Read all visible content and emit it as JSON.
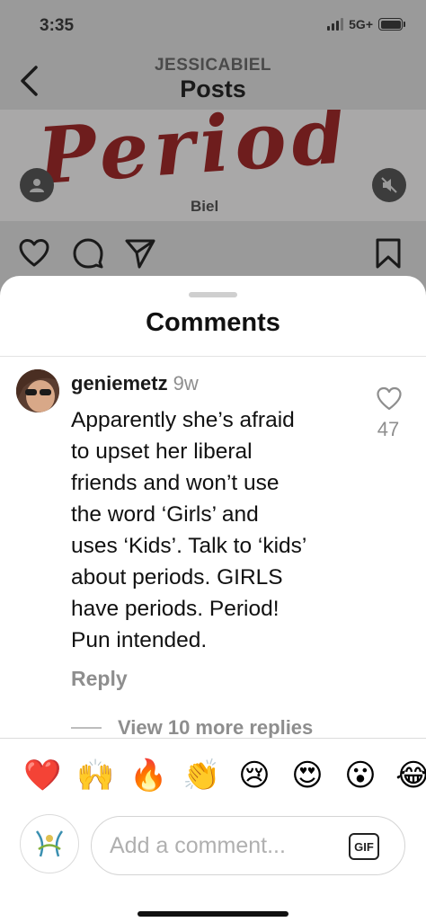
{
  "status_bar": {
    "time": "3:35",
    "network": "5G+"
  },
  "nav": {
    "username": "JESSICABIEL",
    "title": "Posts"
  },
  "post": {
    "image_text": "Period",
    "image_caption": "Biel"
  },
  "comments_sheet": {
    "title": "Comments",
    "comment": {
      "username": "geniemetz",
      "time": "9w",
      "text": "Apparently she’s afraid\nto upset her liberal\nfriends and won’t use\nthe word ‘Girls’ and\nuses ‘Kids’. Talk to ‘kids’\nabout periods. GIRLS\nhave periods.  Period!\nPun intended.",
      "likes": "47",
      "reply_label": "Reply",
      "view_replies": "View 10 more replies"
    },
    "emojis": [
      "❤️",
      "🙌",
      "🔥",
      "👏",
      "😢",
      "😍",
      "😮",
      "😂"
    ],
    "input": {
      "placeholder": "Add a comment...",
      "gif_label": "GIF"
    }
  },
  "colors": {
    "accent_text": "#111111",
    "muted_text": "#8e8e8e",
    "backdrop": "#9a9a9a"
  }
}
